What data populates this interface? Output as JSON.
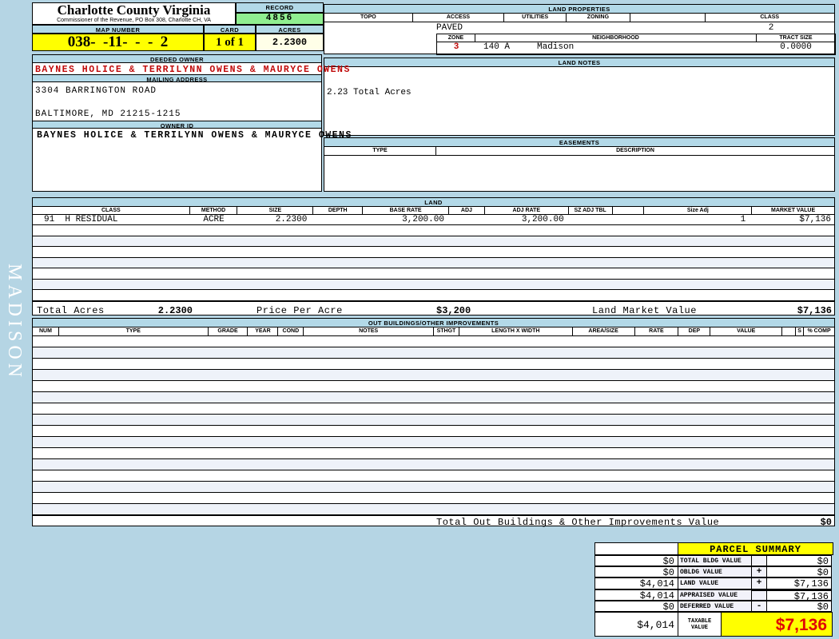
{
  "header": {
    "county_title": "Charlotte County Virginia",
    "commissioner_line": "Commissioner of the Revenue, PO  Box 308, Charlotte CH, VA",
    "record_label": "RECORD",
    "record_value": "4856",
    "map_number_label": "MAP NUMBER",
    "map_number_value": "038-  -11-  -  -  2",
    "card_label": "CARD",
    "card_value": "1 of 1",
    "acres_label": "ACRES",
    "acres_value": "2.2300"
  },
  "land_properties": {
    "title": "LAND PROPERTIES",
    "headers": [
      "TOPO",
      "ACCESS",
      "UTILITIES",
      "ZONING",
      "CLASS"
    ],
    "access_value": "PAVED",
    "class_value": "2",
    "zone_label": "ZONE",
    "zone_value": "3",
    "neighborhood_label": "NEIGHBORHOOD",
    "neighborhood_code": "140 A",
    "neighborhood_name": "Madison",
    "tract_size_label": "TRACT SIZE",
    "tract_size_value": "0.0000"
  },
  "owner": {
    "deeded_owner_label": "DEEDED OWNER",
    "deeded_owner": "BAYNES HOLICE & TERRILYNN OWENS & MAURYCE OWENS",
    "mailing_address_label": "MAILING ADDRESS",
    "address_line1": "3304 BARRINGTON ROAD",
    "address_line2": "BALTIMORE, MD 21215-1215",
    "owner_id_label": "OWNER ID",
    "owner_id": "BAYNES HOLICE & TERRILYNN OWENS & MAURYCE OWENS"
  },
  "land_notes": {
    "title": "LAND NOTES",
    "note": "2.23 Total Acres"
  },
  "easements": {
    "title": "EASEMENTS",
    "type_label": "TYPE",
    "description_label": "DESCRIPTION"
  },
  "land_table": {
    "title": "LAND",
    "headers": [
      "CLASS",
      "METHOD",
      "SIZE",
      "DEPTH",
      "BASE RATE",
      "ADJ",
      "ADJ RATE",
      "SZ ADJ TBL",
      "",
      "Size Adj",
      "MARKET VALUE"
    ],
    "row": {
      "class": "91  H RESIDUAL",
      "method": "ACRE",
      "size": "2.2300",
      "depth": "",
      "base_rate": "3,200.00",
      "adj": "",
      "adj_rate": "3,200.00",
      "sz_adj_tbl": "",
      "size_adj": "1",
      "market_value": "$7,136"
    },
    "totals": {
      "total_acres_label": "Total Acres",
      "total_acres": "2.2300",
      "price_per_acre_label": "Price Per Acre",
      "price_per_acre": "$3,200",
      "land_market_value_label": "Land Market Value",
      "land_market_value": "$7,136"
    }
  },
  "out_buildings": {
    "title": "OUT BUILDINGS/OTHER IMPROVEMENTS",
    "headers": [
      "NUM",
      "TYPE",
      "GRADE",
      "YEAR",
      "COND",
      "NOTES",
      "STHGT",
      "LENGTH X WIDTH",
      "AREA/SIZE",
      "RATE",
      "DEP",
      "VALUE",
      "S",
      "% COMP"
    ],
    "total_label": "Total Out Buildings & Other Improvements Value",
    "total_value": "$0"
  },
  "parcel_summary": {
    "title": "PARCEL SUMMARY",
    "rows": [
      {
        "left": "$0",
        "label": "TOTAL BLDG VALUE",
        "op": "",
        "value": "$0"
      },
      {
        "left": "$0",
        "label": "OBLDG VALUE",
        "op": "+",
        "value": "$0"
      },
      {
        "left": "$4,014",
        "label": "LAND VALUE",
        "op": "+",
        "value": "$7,136"
      },
      {
        "left": "$4,014",
        "label": "APPRAISED VALUE",
        "op": "",
        "value": "$7,136"
      },
      {
        "left": "$0",
        "label": "DEFERRED VALUE",
        "op": "-",
        "value": "$0"
      }
    ],
    "taxable": {
      "left": "$4,014",
      "label_line1": "TAXABLE",
      "label_line2": "VALUE",
      "value": "$7,136"
    }
  },
  "sidebar": {
    "district_name": "MADISON"
  },
  "colors": {
    "page_blue": "#b5d5e4",
    "bar_blue": "#b3d9e8",
    "accent_yellow": "#ffff00",
    "accent_green": "#90ee90",
    "accent_cream": "#ffffe8",
    "alert_red": "#c00a0a"
  }
}
